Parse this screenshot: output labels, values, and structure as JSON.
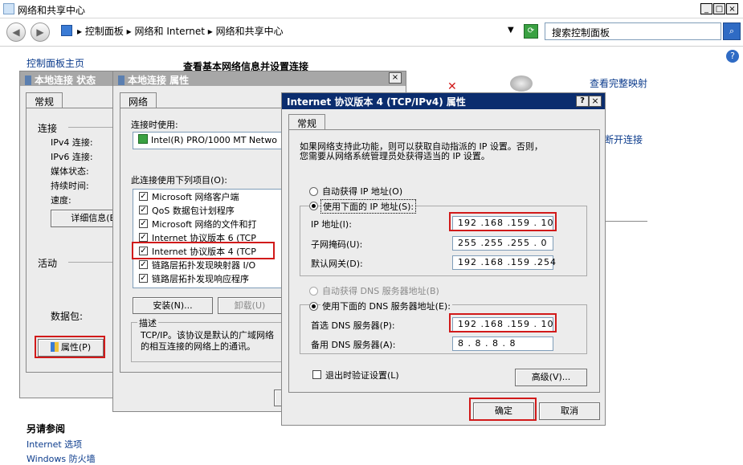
{
  "main_window": {
    "title": "网络和共享中心",
    "crumbs": [
      "控制面板",
      "网络和 Internet",
      "网络和共享中心"
    ],
    "search_placeholder": "搜索控制面板",
    "left_links": [
      "控制面板主页"
    ],
    "heading": "查看基本网络信息并设置连接",
    "view_full_map": "查看完整映射",
    "disconnect": "断开连接",
    "see_also_title": "另请参阅",
    "see_also_links": [
      "Internet 选项",
      "Windows 防火墙"
    ]
  },
  "status_dialog": {
    "title": "本地连接 状态",
    "tab": "常规",
    "section_connection": "连接",
    "rows": [
      "IPv4 连接:",
      "IPv6 连接:",
      "媒体状态:",
      "持续时间:",
      "速度:"
    ],
    "details_button": "详细信息(E)",
    "section_activity": "活动",
    "packets_label": "数据包:",
    "properties_button": "属性(P)"
  },
  "props_dialog": {
    "title": "本地连接 属性",
    "tab": "网络",
    "connect_using_label": "连接时使用:",
    "adapter": "Intel(R) PRO/1000 MT Netwo",
    "items_label": "此连接使用下列项目(O):",
    "items": [
      "Microsoft 网络客户端",
      "QoS 数据包计划程序",
      "Microsoft 网络的文件和打",
      "Internet 协议版本 6 (TCP",
      "Internet 协议版本 4 (TCP",
      "链路层拓扑发现映射器 I/O",
      "链路层拓扑发现响应程序"
    ],
    "install_button": "安装(N)...",
    "uninstall_button": "卸载(U)",
    "description_title": "描述",
    "description_text": [
      "TCP/IP。该协议是默认的广域网络",
      "的相互连接的网络上的通讯。"
    ]
  },
  "ipv4_dialog": {
    "title": "Internet 协议版本 4 (TCP/IPv4) 属性",
    "help": "?",
    "close": "×",
    "tab": "常规",
    "intro": [
      "如果网络支持此功能，则可以获取自动指派的 IP 设置。否则，",
      "您需要从网络系统管理员处获得适当的 IP 设置。"
    ],
    "radio_auto_ip": "自动获得 IP 地址(O)",
    "radio_manual_ip": "使用下面的 IP 地址(S):",
    "ip_label": "IP 地址(I):",
    "ip_value": "192 .168 .159 . 10",
    "mask_label": "子网掩码(U):",
    "mask_value": "255 .255 .255 . 0",
    "gateway_label": "默认网关(D):",
    "gateway_value": "192 .168 .159 .254",
    "radio_auto_dns": "自动获得 DNS 服务器地址(B)",
    "radio_manual_dns": "使用下面的 DNS 服务器地址(E):",
    "dns1_label": "首选 DNS 服务器(P):",
    "dns1_value": "192 .168 .159 . 10",
    "dns2_label": "备用 DNS 服务器(A):",
    "dns2_value": "8 . 8 . 8 . 8",
    "validate_label": "退出时验证设置(L)",
    "advanced_button": "高级(V)...",
    "ok_button": "确定",
    "cancel_button": "取消"
  },
  "colors": {
    "highlight": "#d11a1a",
    "title_active": "#0b2d6e",
    "title_inactive": "#a7a7a7"
  }
}
